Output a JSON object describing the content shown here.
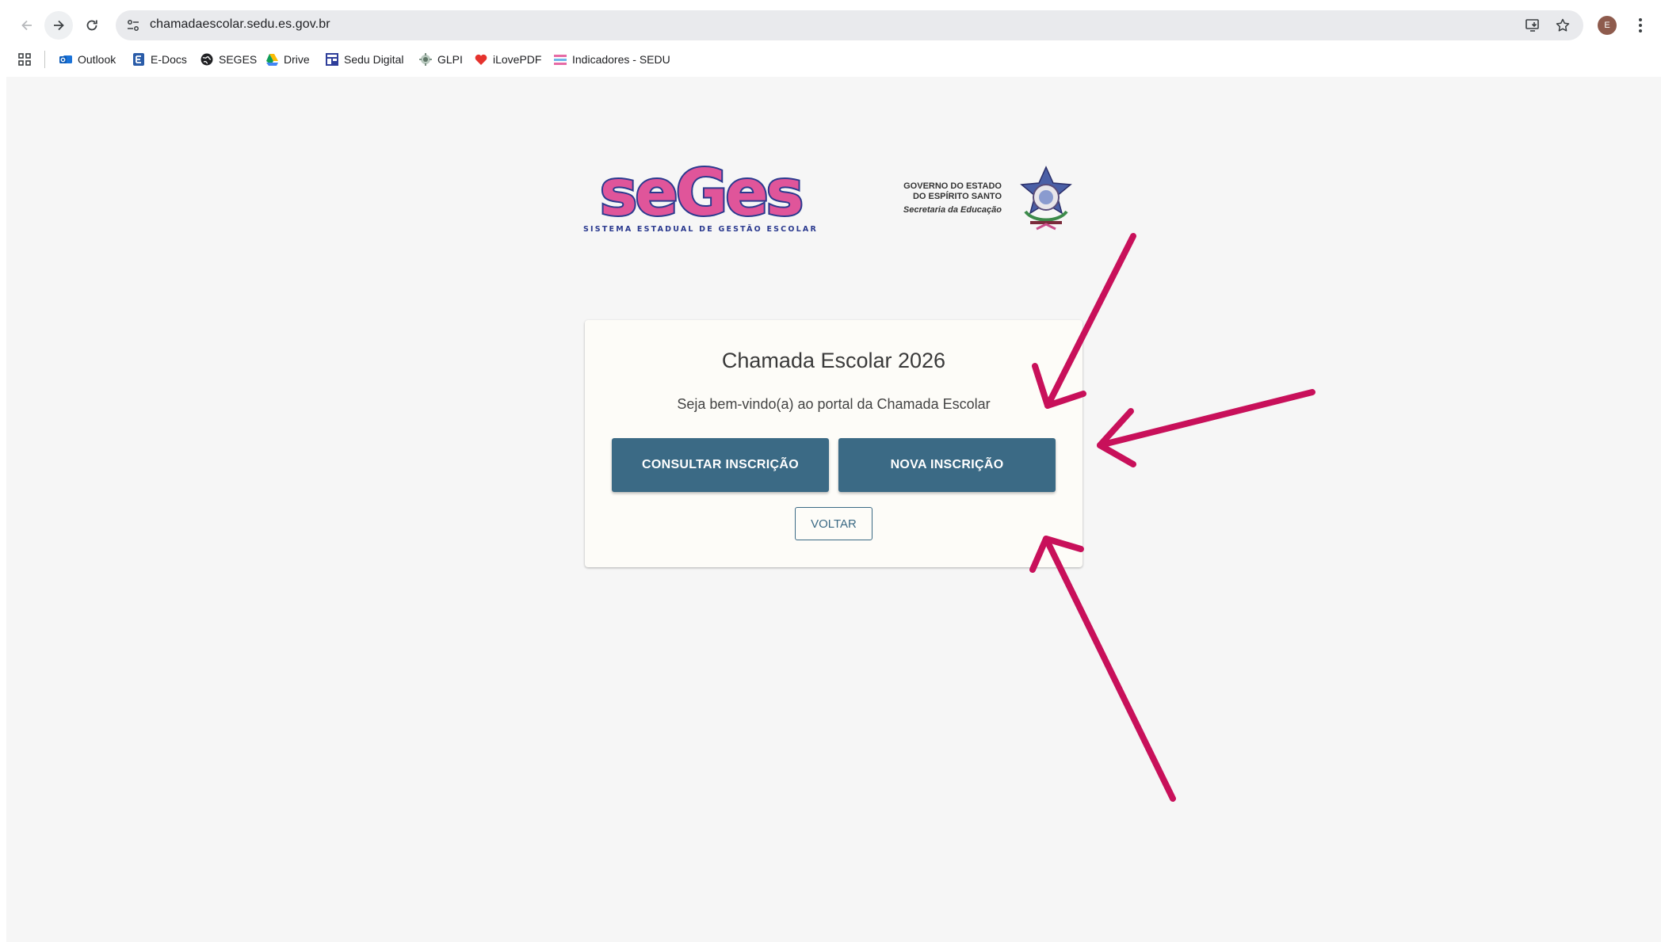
{
  "browser": {
    "url": "chamadaescolar.sedu.es.gov.br",
    "profile_initial": "E",
    "bookmarks": [
      {
        "label": "Outlook",
        "icon": "outlook-icon"
      },
      {
        "label": "E-Docs",
        "icon": "edocs-icon"
      },
      {
        "label": "SEGES",
        "icon": "seges-globe-icon"
      },
      {
        "label": "Drive",
        "icon": "google-drive-icon"
      },
      {
        "label": "Sedu Digital",
        "icon": "sedu-digital-icon"
      },
      {
        "label": "GLPI",
        "icon": "glpi-icon"
      },
      {
        "label": "iLovePDF",
        "icon": "ilovepdf-icon"
      },
      {
        "label": "Indicadores - SEDU",
        "icon": "indicadores-icon"
      }
    ]
  },
  "header": {
    "seges_logo_text": "seGes",
    "seges_tagline": "SISTEMA ESTADUAL DE GESTÃO ESCOLAR",
    "gov_line1": "GOVERNO DO ESTADO",
    "gov_line2": "DO ESPÍRITO SANTO",
    "gov_line3": "Secretaria da Educação"
  },
  "card": {
    "title": "Chamada Escolar 2026",
    "subtitle": "Seja bem-vindo(a) ao portal da Chamada Escolar",
    "consult_button": "CONSULTAR INSCRIÇÃO",
    "new_button": "NOVA INSCRIÇÃO",
    "back_button": "VOLTAR"
  },
  "colors": {
    "primary": "#3b6a85",
    "annotation_arrows": "#c8105a",
    "logo_pink": "#e0559a",
    "logo_blue": "#2b3a8f"
  }
}
